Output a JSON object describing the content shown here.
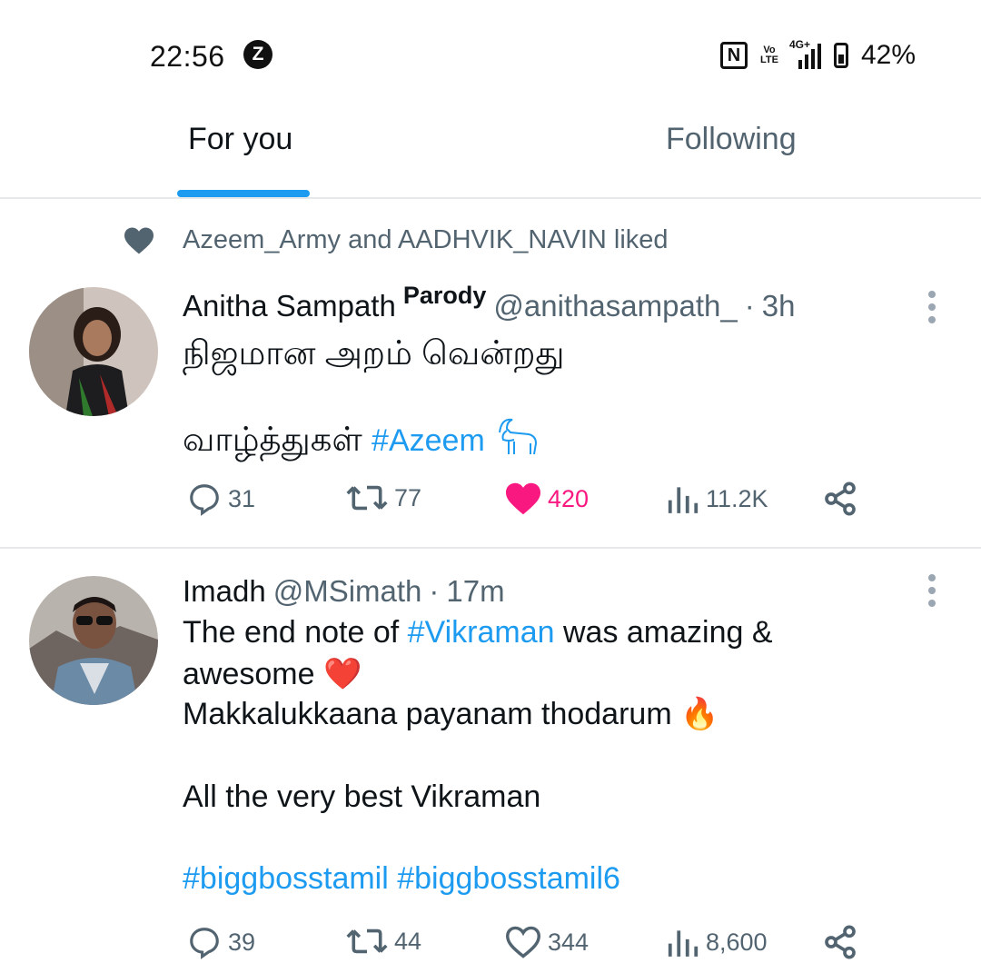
{
  "status_bar": {
    "time": "22:56",
    "notification_icon": "z-app-icon",
    "nfc": "N",
    "volte": "Vo LTE",
    "network": "4G+",
    "battery": "42%"
  },
  "tabs": [
    {
      "label": "For you",
      "active": true
    },
    {
      "label": "Following",
      "active": false
    }
  ],
  "colors": {
    "accent": "#1d9bf0",
    "like": "#f91880",
    "muted": "#536471"
  },
  "tweets": [
    {
      "social_context": "Azeem_Army and AADHVIK_NAVIN liked",
      "name": "Anitha Sampath",
      "label": "Parody",
      "handle": "@anithasampath_",
      "sep": "·",
      "time": "3h",
      "line1": "நிஜமான அறம் வென்றது",
      "line2": "வாழ்த்துகள்",
      "hashtag": "#Azeem",
      "stats": {
        "replies": "31",
        "retweets": "77",
        "likes": "420",
        "views": "11.2K"
      },
      "liked": true
    },
    {
      "name": "Imadh",
      "handle": "@MSimath",
      "sep": "·",
      "time": "17m",
      "line1_pre": "The end note of ",
      "line1_tag": "#Vikraman",
      "line1_post": " was amazing &",
      "line2": "awesome",
      "line2_emoji": "❤️",
      "line3": "Makkalukkaana payanam thodarum",
      "line3_emoji": "🔥",
      "line4": "All the very best Vikraman",
      "hashtags": "#biggbosstamil #biggbosstamil6",
      "stats": {
        "replies": "39",
        "retweets": "44",
        "likes": "344",
        "views": "8,600"
      },
      "liked": false
    }
  ]
}
